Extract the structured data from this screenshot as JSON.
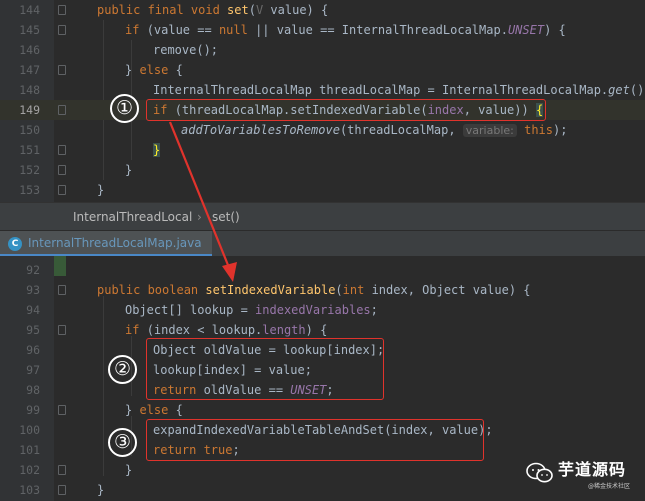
{
  "top_editor": {
    "lines": [
      {
        "num": "144"
      },
      {
        "num": "145"
      },
      {
        "num": "146"
      },
      {
        "num": "147"
      },
      {
        "num": "148"
      },
      {
        "num": "149"
      },
      {
        "num": "150"
      },
      {
        "num": "151"
      },
      {
        "num": "152"
      },
      {
        "num": "153"
      }
    ],
    "code": {
      "l144": {
        "kw": "public final void ",
        "fn": "set",
        "p1": "(",
        "tp": "V",
        "p2": " value) {"
      },
      "l145": {
        "kw": "if ",
        "a": "(value == ",
        "kw2": "null",
        "b": " || value == InternalThreadLocalMap.",
        "cn": "UNSET",
        "c": ") {"
      },
      "l146": {
        "a": "remove();"
      },
      "l147": {
        "a": "} ",
        "kw": "else",
        "b": " {"
      },
      "l148": {
        "a": "InternalThreadLocalMap threadLocalMap = InternalThreadLocalMap.",
        "st": "get",
        "b": "();"
      },
      "l149": {
        "kw": "if ",
        "a": "(threadLocalMap.setIndexedVariable(",
        "fld": "index",
        "b": ", value)) ",
        "brace": "{"
      },
      "l150": {
        "fn": "addToVariablesToRemove",
        "a": "(threadLocalMap, ",
        "hint": "variable:",
        "kw": " this",
        "b": ");"
      },
      "l151": {
        "brace": "}"
      },
      "l152": {
        "a": "}"
      },
      "l153": {
        "a": "}"
      }
    }
  },
  "breadcrumb": {
    "class_name": "InternalThreadLocal",
    "separator": "›",
    "method": "set()"
  },
  "tab": {
    "label": "InternalThreadLocalMap.java",
    "icon": "class-icon"
  },
  "bottom_editor": {
    "lines": [
      {
        "num": "92"
      },
      {
        "num": "93"
      },
      {
        "num": "94"
      },
      {
        "num": "95"
      },
      {
        "num": "96"
      },
      {
        "num": "97"
      },
      {
        "num": "98"
      },
      {
        "num": "99"
      },
      {
        "num": "100"
      },
      {
        "num": "101"
      },
      {
        "num": "102"
      },
      {
        "num": "103"
      }
    ],
    "code": {
      "l93": {
        "kw": "public boolean ",
        "fn": "setIndexedVariable",
        "a": "(",
        "kw2": "int",
        "b": " index, Object value) {"
      },
      "l94": {
        "a": "Object[] lookup = ",
        "fld": "indexedVariables",
        "b": ";"
      },
      "l95": {
        "kw": "if ",
        "a": "(index < lookup.",
        "fld": "length",
        "b": ") {"
      },
      "l96": {
        "a": "Object oldValue = lookup[index];"
      },
      "l97": {
        "a": "lookup[index] = value;"
      },
      "l98": {
        "kw": "return ",
        "a": "oldValue == ",
        "cn": "UNSET",
        "b": ";"
      },
      "l99": {
        "a": "} ",
        "kw": "else",
        "b": " {"
      },
      "l100": {
        "a": "expandIndexedVariableTableAndSet(index, value);"
      },
      "l101": {
        "kw": "return true",
        "b": ";"
      },
      "l102": {
        "a": "}"
      },
      "l103": {
        "a": "}"
      }
    }
  },
  "annotations": {
    "step1": "①",
    "step2": "②",
    "step3": "③"
  },
  "watermark": {
    "title": "芋道源码",
    "subtitle": "@稀金技术社区"
  },
  "colors": {
    "annotation_red": "#e0332c",
    "background": "#2b2b2b",
    "keyword": "#cc7832",
    "method": "#ffc66d",
    "field": "#9876aa"
  }
}
